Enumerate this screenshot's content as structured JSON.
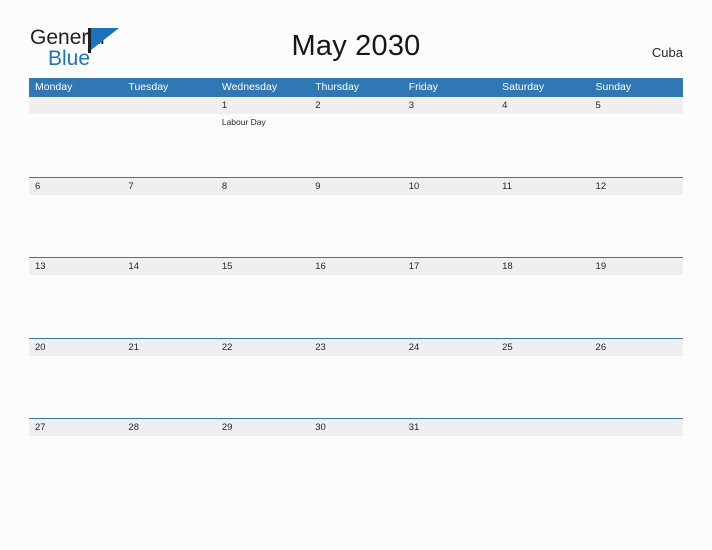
{
  "brand": {
    "word_one": "General",
    "word_two": "Blue",
    "accent_color": "#1a74bb",
    "triangle_icon": "triangle-icon"
  },
  "header": {
    "title": "May 2030",
    "country": "Cuba"
  },
  "theme": {
    "header_blue": "#3077b5",
    "band_gray": "#efefef",
    "page_background": "#fcfcfc",
    "text_color": "#262626"
  },
  "calendar": {
    "weekdays": [
      "Monday",
      "Tuesday",
      "Wednesday",
      "Thursday",
      "Friday",
      "Saturday",
      "Sunday"
    ],
    "weeks": [
      {
        "days": [
          {
            "date": "",
            "event": ""
          },
          {
            "date": "",
            "event": ""
          },
          {
            "date": "1",
            "event": "Labour Day"
          },
          {
            "date": "2",
            "event": ""
          },
          {
            "date": "3",
            "event": ""
          },
          {
            "date": "4",
            "event": ""
          },
          {
            "date": "5",
            "event": ""
          }
        ]
      },
      {
        "days": [
          {
            "date": "6",
            "event": ""
          },
          {
            "date": "7",
            "event": ""
          },
          {
            "date": "8",
            "event": ""
          },
          {
            "date": "9",
            "event": ""
          },
          {
            "date": "10",
            "event": ""
          },
          {
            "date": "11",
            "event": ""
          },
          {
            "date": "12",
            "event": ""
          }
        ]
      },
      {
        "days": [
          {
            "date": "13",
            "event": ""
          },
          {
            "date": "14",
            "event": ""
          },
          {
            "date": "15",
            "event": ""
          },
          {
            "date": "16",
            "event": ""
          },
          {
            "date": "17",
            "event": ""
          },
          {
            "date": "18",
            "event": ""
          },
          {
            "date": "19",
            "event": ""
          }
        ]
      },
      {
        "days": [
          {
            "date": "20",
            "event": ""
          },
          {
            "date": "21",
            "event": ""
          },
          {
            "date": "22",
            "event": ""
          },
          {
            "date": "23",
            "event": ""
          },
          {
            "date": "24",
            "event": ""
          },
          {
            "date": "25",
            "event": ""
          },
          {
            "date": "26",
            "event": ""
          }
        ]
      },
      {
        "days": [
          {
            "date": "27",
            "event": ""
          },
          {
            "date": "28",
            "event": ""
          },
          {
            "date": "29",
            "event": ""
          },
          {
            "date": "30",
            "event": ""
          },
          {
            "date": "31",
            "event": ""
          },
          {
            "date": "",
            "event": ""
          },
          {
            "date": "",
            "event": ""
          }
        ]
      }
    ]
  }
}
